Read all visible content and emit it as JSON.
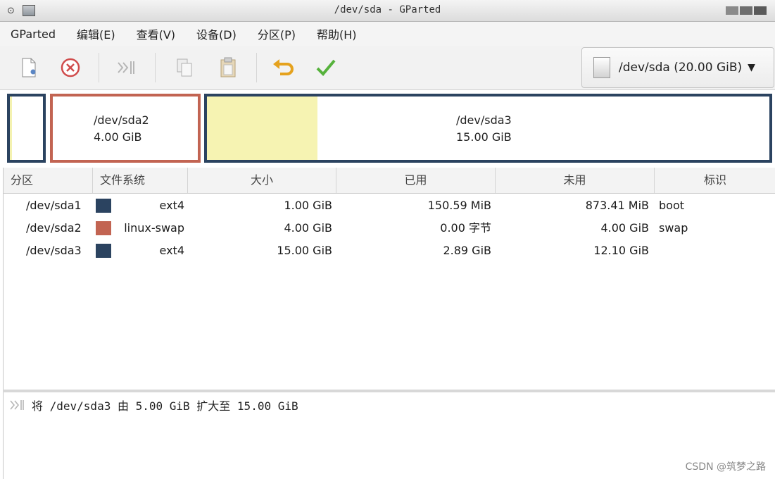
{
  "window": {
    "title": "/dev/sda - GParted"
  },
  "menu": [
    "GParted",
    "编辑(E)",
    "查看(V)",
    "设备(D)",
    "分区(P)",
    "帮助(H)"
  ],
  "toolbar": {
    "buttons": [
      "new-icon",
      "delete-icon",
      "resize-move-icon",
      "copy-icon",
      "paste-icon",
      "undo-icon",
      "apply-icon"
    ],
    "device": "/dev/sda (20.00 GiB)"
  },
  "map": {
    "partitions": [
      {
        "name": "/dev/sda1",
        "color": "#2b4360",
        "used_fraction": 0.147
      },
      {
        "name": "/dev/sda2",
        "size": "4.00 GiB",
        "color": "#c26452"
      },
      {
        "name": "/dev/sda3",
        "size": "15.00 GiB",
        "color": "#2b4360",
        "used_fraction": 0.193
      }
    ]
  },
  "table": {
    "columns": [
      "分区",
      "文件系统",
      "大小",
      "已用",
      "未用",
      "标识"
    ],
    "rows": [
      {
        "partition": "/dev/sda1",
        "color": "#2b4360",
        "fs": "ext4",
        "size": "1.00 GiB",
        "used": "150.59 MiB",
        "unused": "873.41 MiB",
        "flags": "boot"
      },
      {
        "partition": "/dev/sda2",
        "color": "#c26452",
        "fs": "linux-swap",
        "size": "4.00 GiB",
        "used": "0.00 字节",
        "unused": "4.00 GiB",
        "flags": "swap"
      },
      {
        "partition": "/dev/sda3",
        "color": "#2b4360",
        "fs": "ext4",
        "size": "15.00 GiB",
        "used": "2.89 GiB",
        "unused": "12.10 GiB",
        "flags": ""
      }
    ]
  },
  "pending_ops": [
    "将 /dev/sda3 由 5.00 GiB 扩大至 15.00 GiB"
  ],
  "watermark": "CSDN @筑梦之路"
}
